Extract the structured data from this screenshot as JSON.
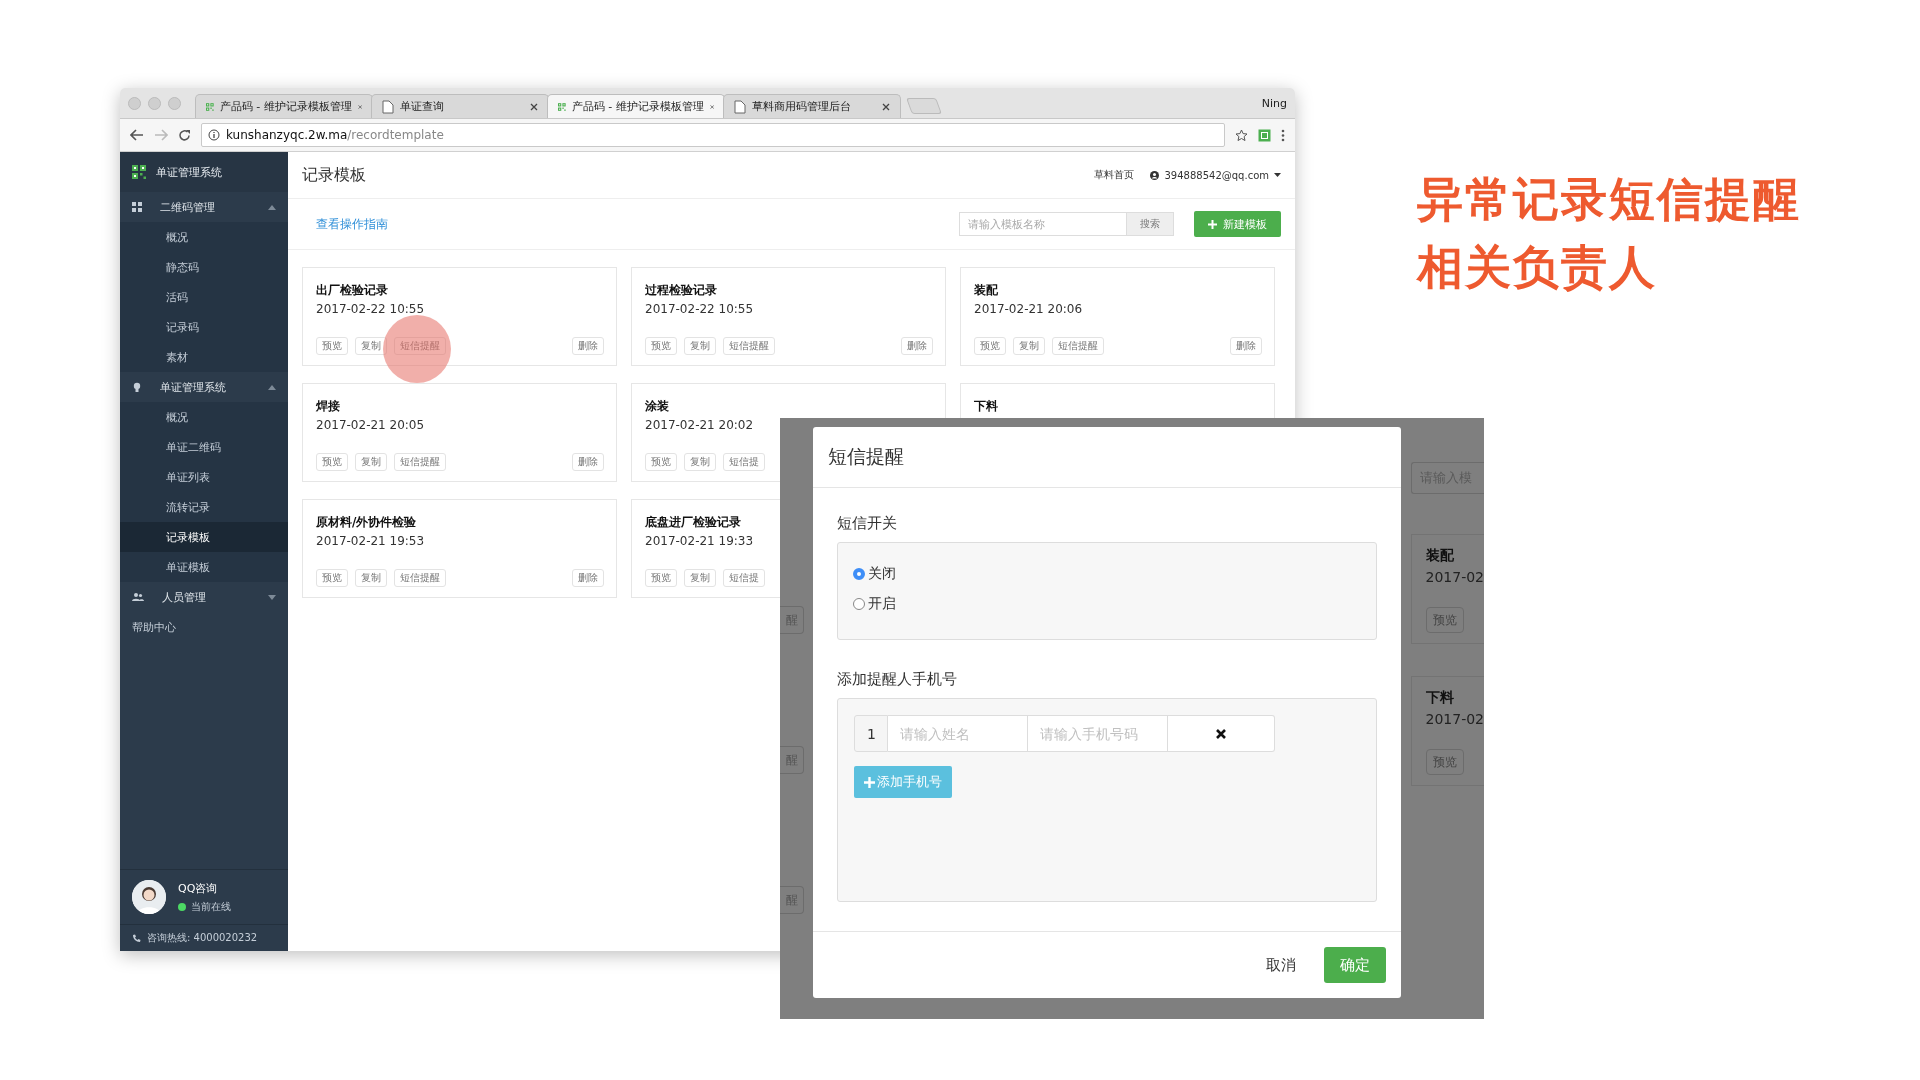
{
  "browser": {
    "tabs": [
      {
        "title": "产品码 - 维护记录模板管理",
        "kind": "qr",
        "selected": false
      },
      {
        "title": "单证查询",
        "kind": "page",
        "selected": false
      },
      {
        "title": "产品码 - 维护记录模板管理",
        "kind": "qr",
        "selected": true
      },
      {
        "title": "草料商用码管理后台",
        "kind": "page",
        "selected": false
      }
    ],
    "profile": "Ning",
    "url_host": "kunshanzyqc.2w.ma",
    "url_path": "/recordtemplate"
  },
  "sidebar": {
    "brand": "单证管理系统",
    "groups": [
      {
        "label": "二维码管理",
        "kind": "grid",
        "expanded": true,
        "items": [
          {
            "label": "概况",
            "selected": false
          },
          {
            "label": "静态码",
            "selected": false
          },
          {
            "label": "活码",
            "selected": false
          },
          {
            "label": "记录码",
            "selected": false
          },
          {
            "label": "素材",
            "selected": false
          }
        ]
      },
      {
        "label": "单证管理系统",
        "kind": "bulb",
        "expanded": true,
        "items": [
          {
            "label": "概况",
            "selected": false
          },
          {
            "label": "单证二维码",
            "selected": false
          },
          {
            "label": "单证列表",
            "selected": false
          },
          {
            "label": "流转记录",
            "selected": false
          },
          {
            "label": "记录模板",
            "selected": true
          },
          {
            "label": "单证模板",
            "selected": false
          }
        ]
      },
      {
        "label": "人员管理",
        "kind": "people",
        "expanded": false
      }
    ],
    "help": "帮助中心",
    "support": {
      "name": "QQ咨询",
      "status": "当前在线",
      "online": true,
      "hotline": "咨询热线: 4000020232"
    }
  },
  "header": {
    "title": "记录模板",
    "home_link": "草料首页",
    "account": "394888542@qq.com"
  },
  "toolbar": {
    "guide_link": "查看操作指南",
    "search": {
      "placeholder": "请输入模板名称",
      "button": "搜索"
    },
    "new_button": "新建模板"
  },
  "cards": [
    {
      "title": "出厂检验记录",
      "date": "2017-02-22 10:55",
      "actions": [
        "预览",
        "复制",
        "短信提醒"
      ],
      "delete": "删除",
      "highlighted": true
    },
    {
      "title": "过程检验记录",
      "date": "2017-02-22 10:55",
      "actions": [
        "预览",
        "复制",
        "短信提醒"
      ],
      "delete": "删除",
      "highlighted": false
    },
    {
      "title": "装配",
      "date": "2017-02-21 20:06",
      "actions": [
        "预览",
        "复制",
        "短信提醒"
      ],
      "delete": "删除",
      "highlighted": false
    },
    {
      "title": "焊接",
      "date": "2017-02-21 20:05",
      "actions": [
        "预览",
        "复制",
        "短信提醒"
      ],
      "delete": "删除",
      "highlighted": false
    },
    {
      "title": "涂装",
      "date": "2017-02-21 20:02",
      "actions": [
        "预览",
        "复制",
        "短信提"
      ],
      "highlighted": false
    },
    {
      "title": "下料",
      "highlighted": false
    },
    {
      "title": "原材料/外协件检验",
      "date": "2017-02-21 19:53",
      "actions": [
        "预览",
        "复制",
        "短信提醒"
      ],
      "delete": "删除",
      "highlighted": false
    },
    {
      "title": "底盘进厂检验记录",
      "date": "2017-02-21 19:33",
      "actions": [
        "预览",
        "复制",
        "短信提"
      ],
      "highlighted": false
    }
  ],
  "inset": {
    "left_fragments": [
      "醒",
      "醒",
      "醒"
    ],
    "search_fragment": "请输入模",
    "right_cards": [
      {
        "title": "装配",
        "date": "2017-02",
        "action": "预览"
      },
      {
        "title": "下料",
        "date": "2017-02",
        "action": "预览"
      }
    ],
    "dialog": {
      "title": "短信提醒",
      "switch_label": "短信开关",
      "options": [
        {
          "label": "关闭",
          "selected": true
        },
        {
          "label": "开启",
          "selected": false
        }
      ],
      "phones_label": "添加提醒人手机号",
      "phones": [
        {
          "index": "1",
          "name_placeholder": "请输入姓名",
          "phone_placeholder": "请输入手机号码"
        }
      ],
      "add_button": "添加手机号",
      "cancel": "取消",
      "confirm": "确定"
    }
  },
  "caption": [
    "异常记录短信提醒",
    "相关负责人"
  ]
}
